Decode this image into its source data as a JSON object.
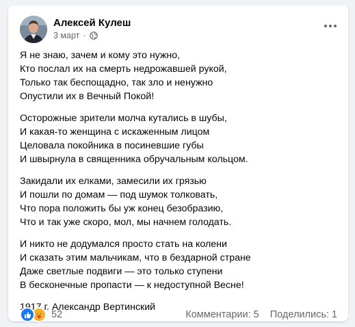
{
  "post": {
    "author": "Алексей Кулеш",
    "date": "3 март",
    "date_separator": "·",
    "privacy_icon": "globe-icon",
    "more_icon": "more-horizontal-icon",
    "stanzas": [
      [
        "Я не знаю, зачем и кому это нужно,",
        "Кто послал их на смерть недрожавшей рукой,",
        "Только так беспощадно, так зло и ненужно",
        "Опустили их в Вечный Покой!"
      ],
      [
        "Осторожные зрители молча кутались в шубы,",
        "И какая-то женщина с искаженным лицом",
        "Целовала покойника в посиневшие губы",
        "И швырнула в священника обручальным кольцом."
      ],
      [
        "Закидали их елками, замесили их грязью",
        "И пошли по домам — под шумок толковать,",
        "Что пора положить бы уж конец безобразию,",
        "Что и так уже скоро, мол, мы начнем голодать."
      ],
      [
        "И никто не додумался просто стать на колени",
        "И сказать этим мальчикам, что в бездарной стране",
        "Даже светлые подвиги — это только ступени",
        "В бесконечные пропасти — к недоступной Весне!"
      ]
    ],
    "signature": "1917 г. Александр Вертинский"
  },
  "footer": {
    "reaction_icons": [
      "like-icon",
      "care-icon"
    ],
    "reaction_count": "52",
    "comments": "Комментарии: 5",
    "shares": "Поделились: 1"
  },
  "colors": {
    "background": "#f0f2f5",
    "card": "#ffffff",
    "text": "#050505",
    "secondary_text": "#65676b",
    "like_blue": "#1877f2",
    "care_yellow": "#f7b125"
  }
}
